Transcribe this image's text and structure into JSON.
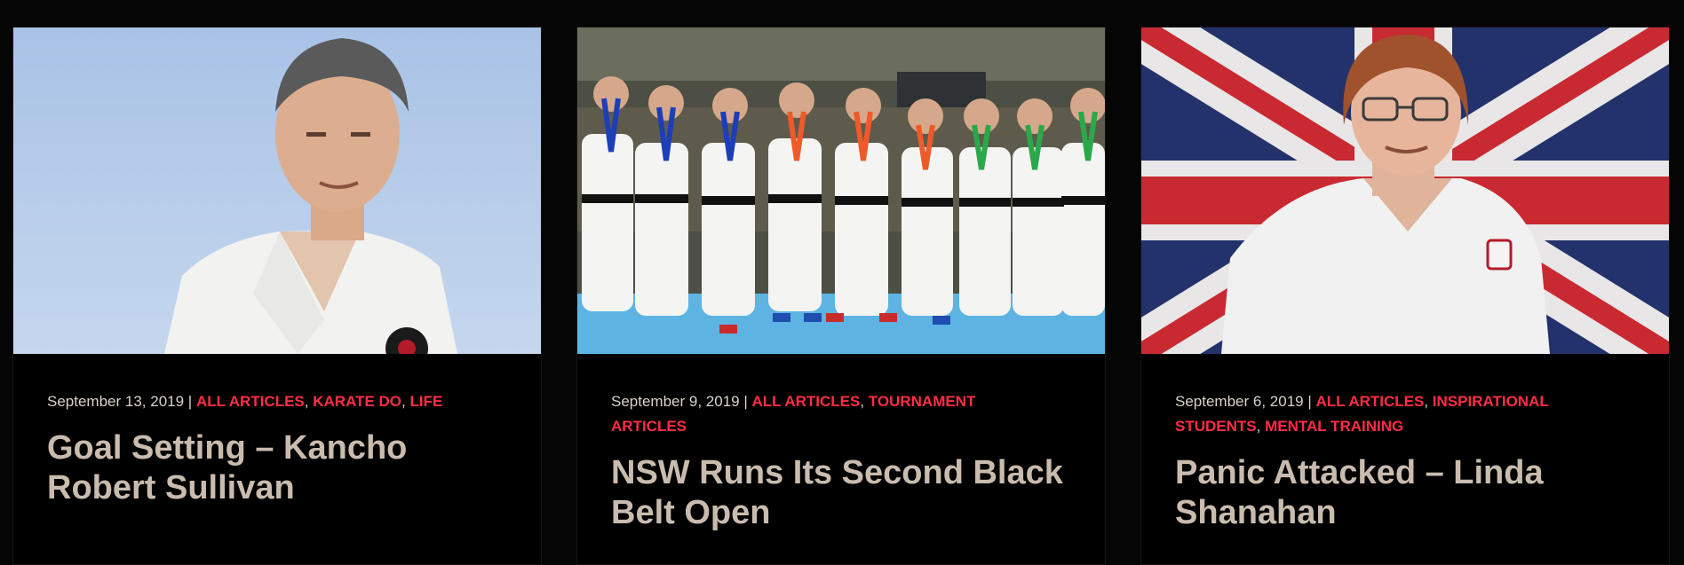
{
  "posts": [
    {
      "date": "September 13, 2019",
      "sep": " | ",
      "categories": [
        "All Articles",
        "Karate Do",
        "Life"
      ],
      "title": "Goal Setting – Kancho Robert Sullivan"
    },
    {
      "date": "September 9, 2019",
      "sep": " | ",
      "categories": [
        "All Articles",
        "Tournament Articles"
      ],
      "title": "NSW Runs Its Second Black Belt Open"
    },
    {
      "date": "September 6, 2019",
      "sep": " | ",
      "categories": [
        "All Articles",
        "Inspirational Students",
        "Mental Training"
      ],
      "title": "Panic Attacked – Linda Shanahan"
    }
  ],
  "colors": {
    "background": "#050505",
    "card": "#000000",
    "category": "#ff2d46",
    "meta_text": "#d9d2c8",
    "title": "#c9bcae"
  }
}
